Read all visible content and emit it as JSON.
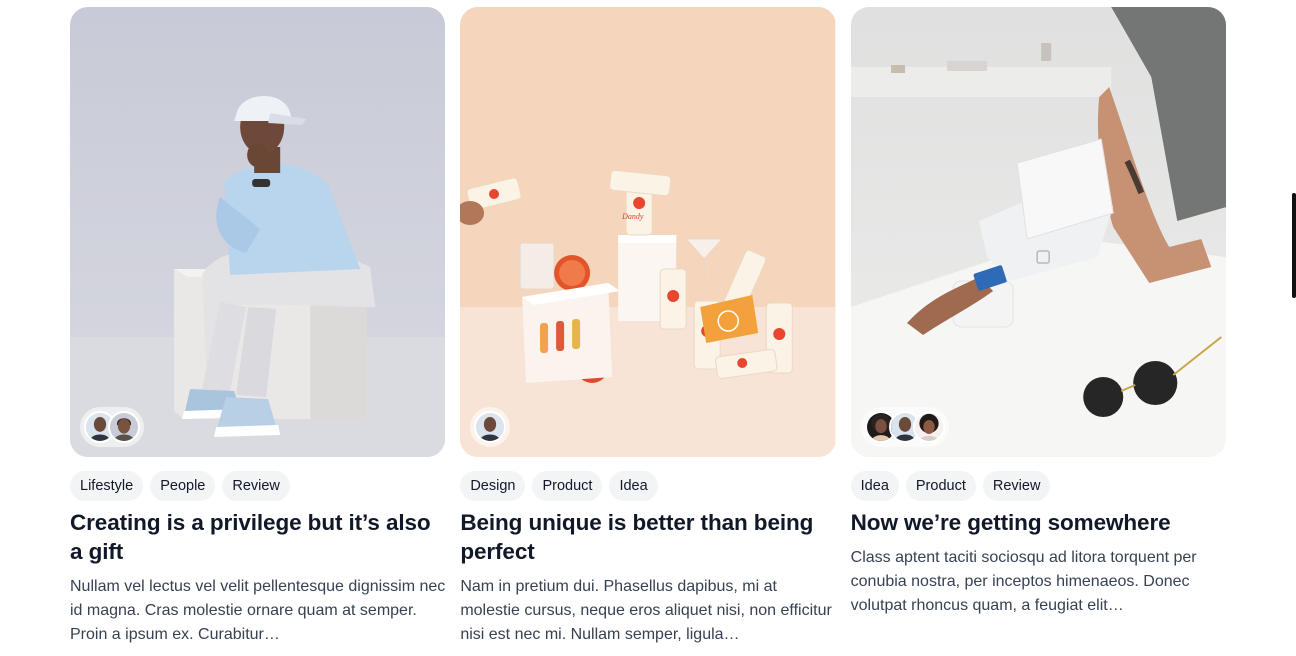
{
  "cards": [
    {
      "tags": [
        "Lifestyle",
        "People",
        "Review"
      ],
      "title": "Creating is a privilege but it’s also a gift",
      "description": "Nullam vel lectus vel velit pellentesque dignissim nec id magna. Cras molestie ornare quam at semper. Proin a ipsum ex. Curabitur…",
      "image": "man-seated-on-white-cube",
      "avatars": [
        "avatar-1",
        "avatar-2"
      ]
    },
    {
      "tags": [
        "Design",
        "Product",
        "Idea"
      ],
      "title": "Being unique is better than being perfect",
      "description": "Nam in pretium dui. Phasellus dapibus, mi at molestie cursus, neque eros aliquet nisi, non efficitur nisi est nec mi. Nullam semper, ligula…",
      "image": "dandy-cans-product-shot",
      "image_text": "Dandy",
      "avatars": [
        "avatar-1"
      ]
    },
    {
      "tags": [
        "Idea",
        "Product",
        "Review"
      ],
      "title": "Now we’re getting somewhere",
      "description": "Class aptent taciti sociosqu ad litora torquent per conubia nostra, per inceptos himenaeos. Donec volutpat rhoncus quam, a feugiat elit…",
      "image": "card-payment-terminal-counter",
      "avatars": [
        "avatar-1",
        "avatar-2",
        "avatar-3"
      ]
    }
  ],
  "colors": {
    "tag_bg": "#f3f4f6",
    "title": "#111827",
    "body_text": "#374151",
    "card1_bg": "#c9cbd7",
    "card2_bg": "#f5d6bd",
    "card3_bg": "#e5e6e6"
  }
}
